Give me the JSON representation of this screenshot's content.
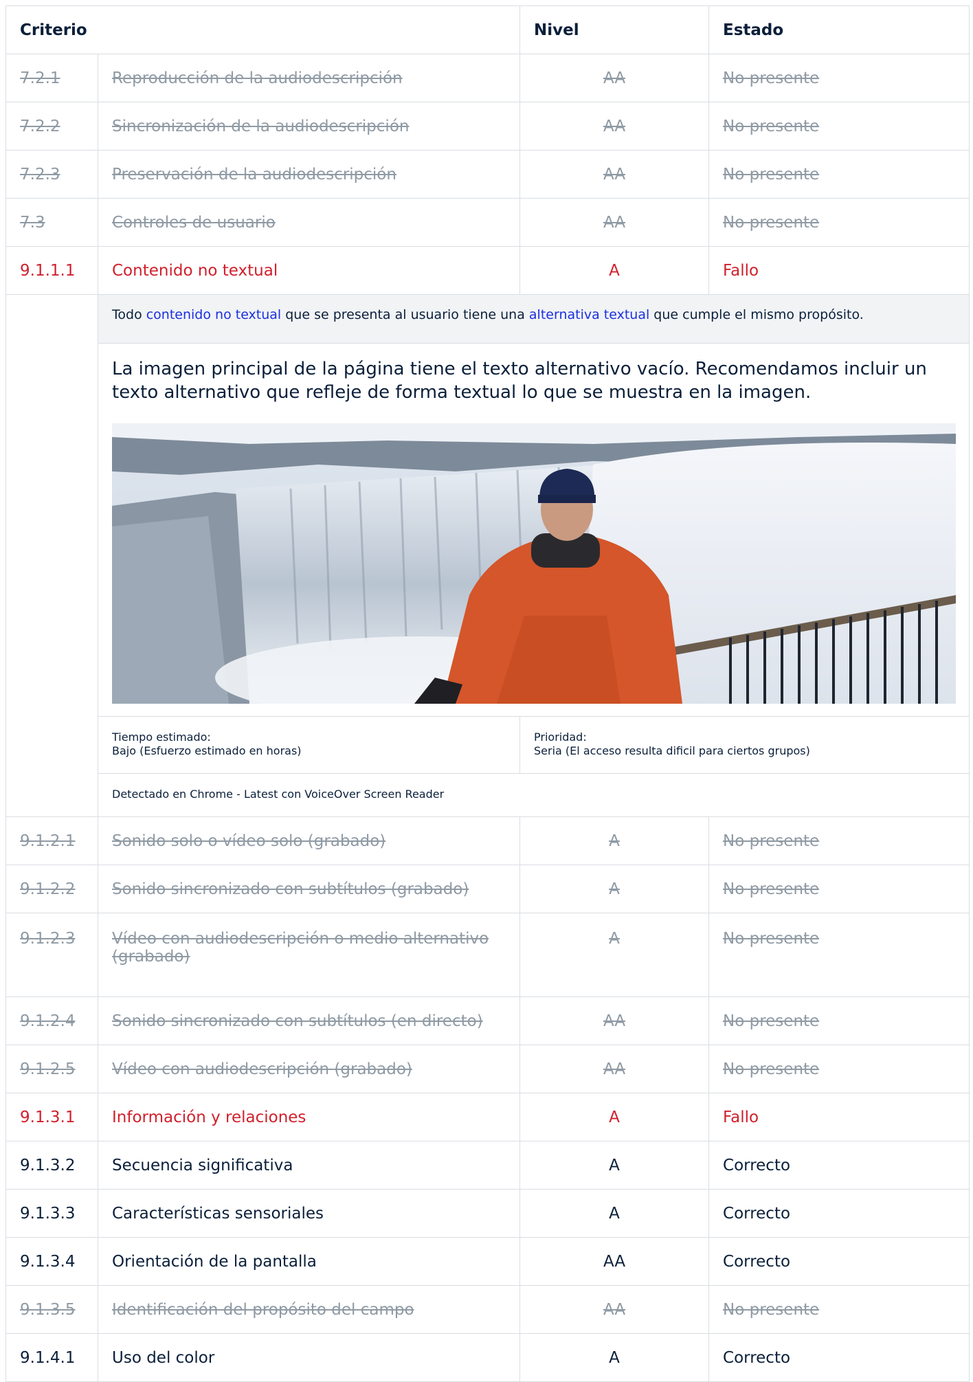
{
  "headers": {
    "criterio": "Criterio",
    "nivel": "Nivel",
    "estado": "Estado"
  },
  "rows_top": [
    {
      "id": "7.2.1",
      "name": "Reproducción de la audiodescripción",
      "level": "AA",
      "status": "No presente"
    },
    {
      "id": "7.2.2",
      "name": "Sincronización de la audiodescripción",
      "level": "AA",
      "status": "No presente"
    },
    {
      "id": "7.2.3",
      "name": "Preservación de la audiodescripción",
      "level": "AA",
      "status": "No presente"
    },
    {
      "id": "7.3",
      "name": "Controles de usuario",
      "level": "AA",
      "status": "No presente"
    },
    {
      "id": "9.1.1.1",
      "name": "Contenido no textual",
      "level": "A",
      "status": "Fallo"
    }
  ],
  "detail": {
    "desc_pre": "Todo ",
    "desc_link1": "contenido no textual",
    "desc_mid": " que se presenta al usuario tiene una ",
    "desc_link2": "alternativa textual",
    "desc_post": " que cumple el mismo propósito.",
    "note": "La imagen principal de la página tiene el texto alternativo vacío. Recomendamos incluir un texto alternativo que refleje de forma textual lo que se muestra en la imagen.",
    "time_label": "Tiempo estimado:",
    "time_value": "Bajo (Esfuerzo estimado en horas)",
    "priority_label": "Prioridad:",
    "priority_value": "Seria (El acceso resulta dificil para ciertos grupos)",
    "detected": "Detectado en Chrome - Latest con VoiceOver Screen Reader"
  },
  "rows_bottom": [
    {
      "id": "9.1.2.1",
      "name": "Sonido solo o vídeo solo (grabado)",
      "level": "A",
      "status": "No presente"
    },
    {
      "id": "9.1.2.2",
      "name": "Sonido sincronizado con subtítulos (grabado)",
      "level": "A",
      "status": "No presente"
    },
    {
      "id": "9.1.2.3",
      "name": "Vídeo con audiodescripción o medio alternativo (grabado)",
      "level": "A",
      "status": "No presente"
    },
    {
      "id": "9.1.2.4",
      "name": "Sonido sincronizado con subtítulos (en directo)",
      "level": "AA",
      "status": "No presente"
    },
    {
      "id": "9.1.2.5",
      "name": "Vídeo con audiodescripción (grabado)",
      "level": "AA",
      "status": "No presente"
    },
    {
      "id": "9.1.3.1",
      "name": "Información y relaciones",
      "level": "A",
      "status": "Fallo"
    },
    {
      "id": "9.1.3.2",
      "name": "Secuencia significativa",
      "level": "A",
      "status": "Correcto"
    },
    {
      "id": "9.1.3.3",
      "name": "Características sensoriales",
      "level": "A",
      "status": "Correcto"
    },
    {
      "id": "9.1.3.4",
      "name": "Orientación de la pantalla",
      "level": "AA",
      "status": "Correcto"
    },
    {
      "id": "9.1.3.5",
      "name": "Identificación del propósito del campo",
      "level": "AA",
      "status": "No presente"
    },
    {
      "id": "9.1.4.1",
      "name": "Uso del color",
      "level": "A",
      "status": "Correcto"
    }
  ]
}
